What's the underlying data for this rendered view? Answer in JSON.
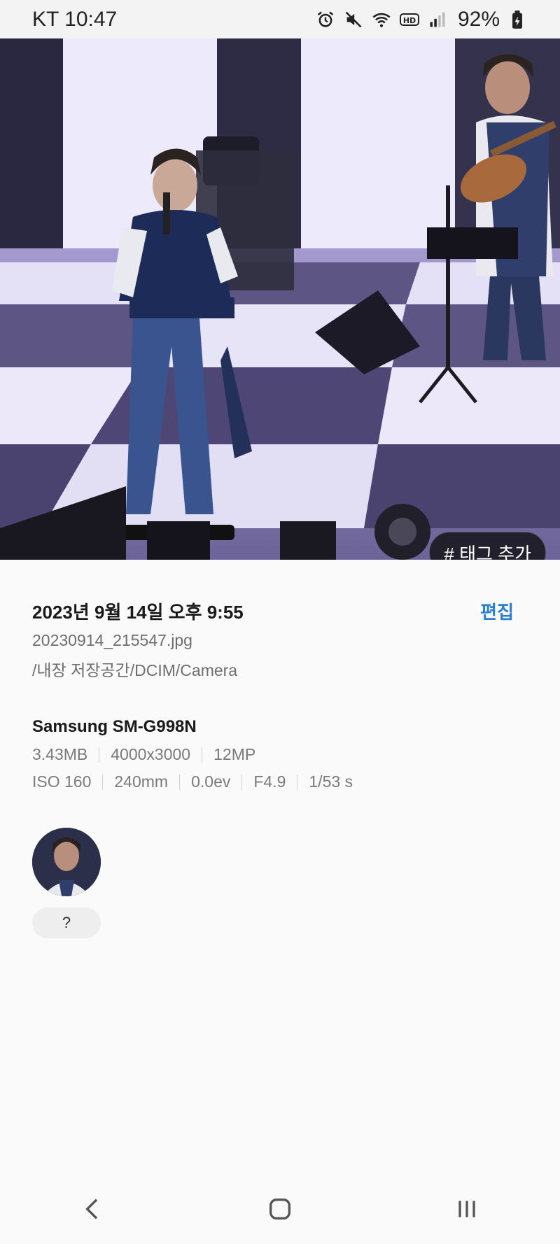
{
  "status_bar": {
    "time": "KT 10:47",
    "battery": "92%",
    "icons": [
      "alarm-icon",
      "mute-icon",
      "wifi-icon",
      "hd-icon",
      "signal-icon",
      "battery-icon"
    ]
  },
  "photo": {
    "tag_button_label": "# 태그 추가"
  },
  "details": {
    "date": "2023년 9월 14일 오후 9:55",
    "edit_label": "편집",
    "filename": "20230914_215547.jpg",
    "path": "/내장 저장공간/DCIM/Camera",
    "device": "Samsung SM-G998N",
    "file_specs": [
      "3.43MB",
      "4000x3000",
      "12MP"
    ],
    "camera_specs": [
      "ISO 160",
      "240mm",
      "0.0ev",
      "F4.9",
      "1/53 s"
    ]
  },
  "people": {
    "face_label": "?"
  },
  "nav_bar": {
    "buttons": [
      "back-icon",
      "home-icon",
      "recents-icon"
    ]
  }
}
